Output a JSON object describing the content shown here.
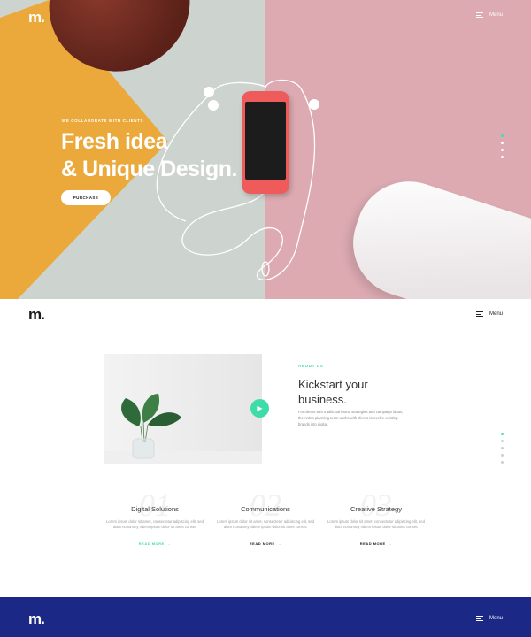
{
  "colors": {
    "accent": "#3fdcaa",
    "navy": "#1c2885",
    "yellow": "#eaa93a",
    "pink": "#ddaab2"
  },
  "hero": {
    "logo": "m.",
    "menu_label": "Menu",
    "kicker": "WE COLLABORATE WITH CLIENTS",
    "title_line1": "Fresh idea",
    "title_line2": "& Unique Design.",
    "cta_label": "PURCHASE",
    "slides": 4,
    "active_slide": 1
  },
  "about": {
    "logo": "m.",
    "menu_label": "Menu",
    "eyebrow": "ABOUT US",
    "heading": "Kickstart your business.",
    "description": "For clients with traditional brand strategies and campaign ideas, the Arden planning team works with clients to evolve existing brands into digital.",
    "slides": 5,
    "active_slide": 1
  },
  "features": [
    {
      "number": "01",
      "title": "Digital Solutions",
      "text": "Lorem ipsum dolor sit amet, consectetur adipiscing elit, sed diam nonummy nibem ipsum dolor sit amet consec",
      "link": "READ MORE"
    },
    {
      "number": "02",
      "title": "Communications",
      "text": "Lorem ipsum dolor sit amet, consectetur adipiscing elit, sed diam nonummy nibem ipsum dolor sit amet consec",
      "link": "READ MORE"
    },
    {
      "number": "03",
      "title": "Creative Strategy",
      "text": "Lorem ipsum dolor sit amet, consectetur adipiscing elit, sed diam nonummy nibem ipsum dolor sit amet consec",
      "link": "READ MORE"
    }
  ],
  "footer": {
    "logo": "m.",
    "menu_label": "Menu"
  }
}
